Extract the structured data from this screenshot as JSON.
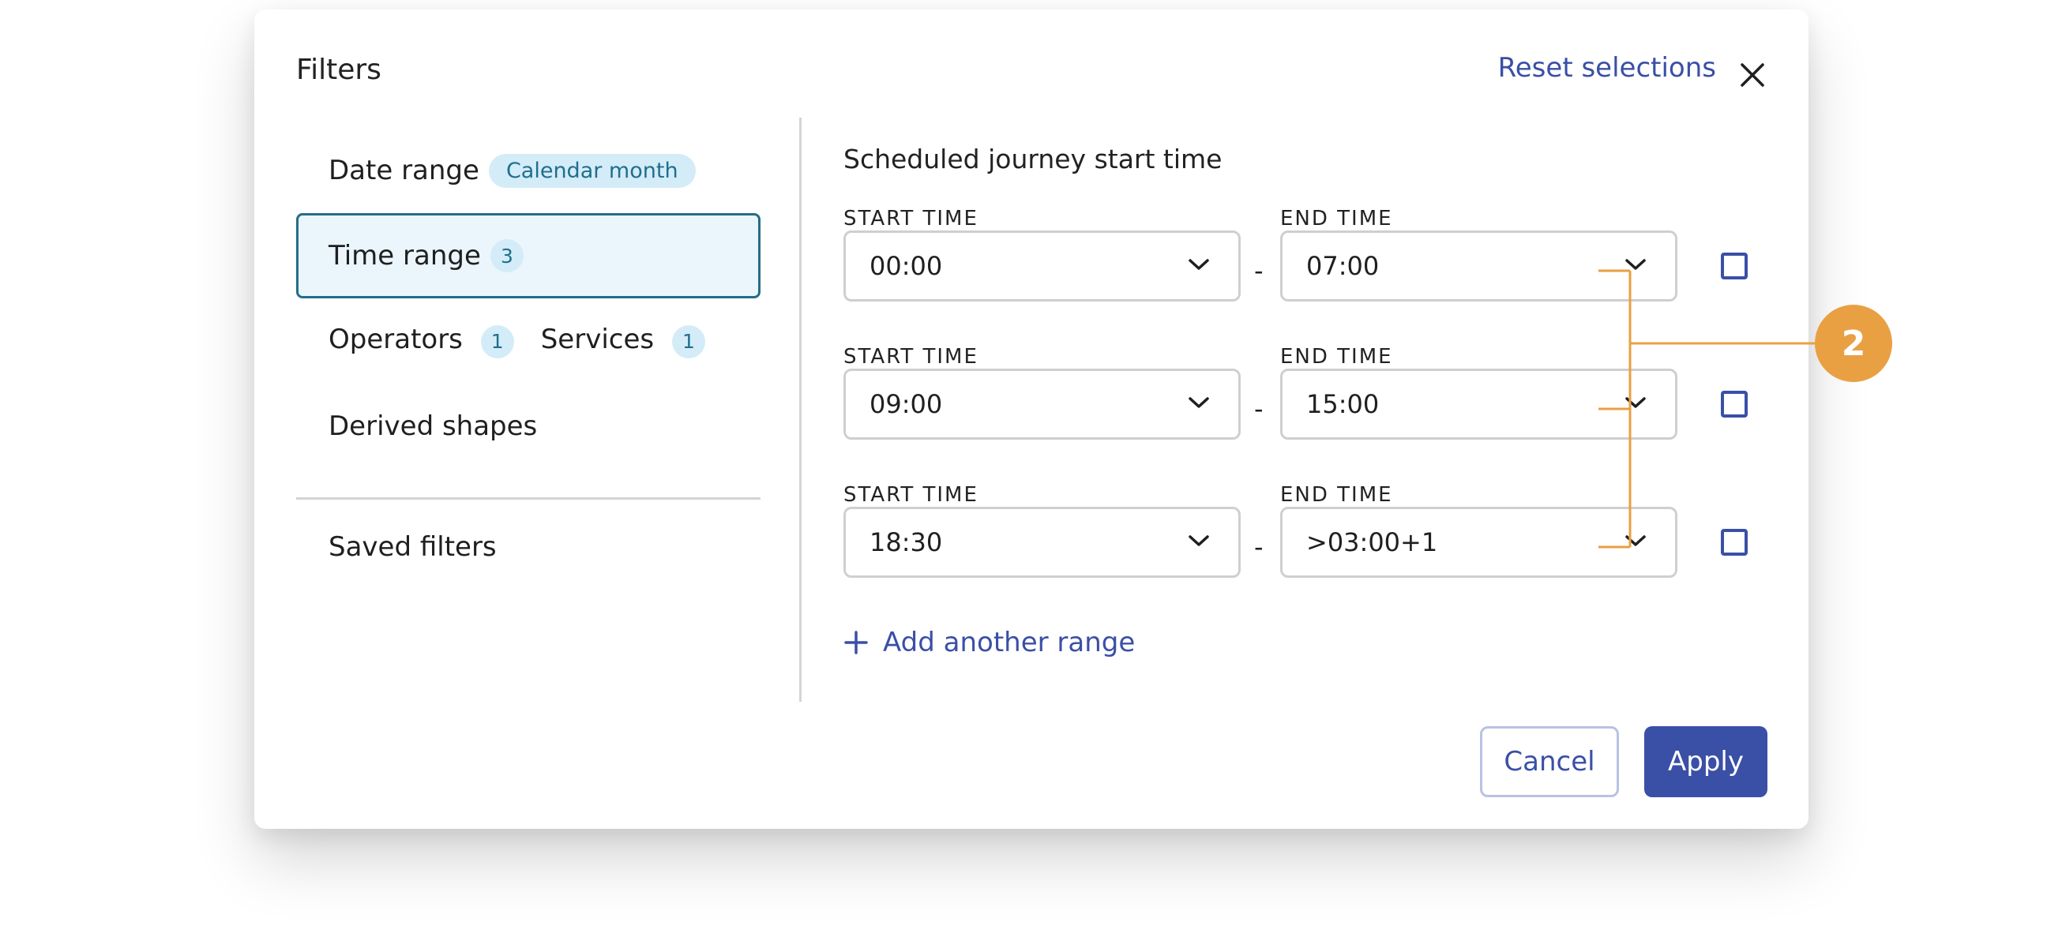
{
  "modal": {
    "title": "Filters",
    "reset_label": "Reset selections"
  },
  "sidebar": {
    "date_range": {
      "label": "Date range",
      "pill": "Calendar month"
    },
    "time_range": {
      "label": "Time range",
      "count": "3"
    },
    "operators": {
      "label": "Operators",
      "count": "1"
    },
    "services": {
      "label": "Services",
      "count": "1"
    },
    "derived_shapes": {
      "label": "Derived shapes"
    },
    "saved_filters": {
      "label": "Saved filters"
    }
  },
  "panel": {
    "title": "Scheduled journey start time",
    "start_label": "START TIME",
    "end_label": "END TIME",
    "separator": "-",
    "ranges": [
      {
        "start": "00:00",
        "end": "07:00",
        "checked": false
      },
      {
        "start": "09:00",
        "end": "15:00",
        "checked": false
      },
      {
        "start": "18:30",
        "end": ">03:00+1",
        "checked": false
      }
    ],
    "add_label": "Add another range"
  },
  "footer": {
    "cancel_label": "Cancel",
    "apply_label": "Apply"
  },
  "annotation": {
    "marker": "2",
    "color": "#e9a043"
  },
  "colors": {
    "accent": "#3a4fa6",
    "active_border": "#236e86",
    "active_bg": "#eaf6fc",
    "pill_bg": "#d4ecf8"
  },
  "icons": {
    "close": "close-icon",
    "dropdown": "chevron-down-icon",
    "add": "plus-icon"
  }
}
